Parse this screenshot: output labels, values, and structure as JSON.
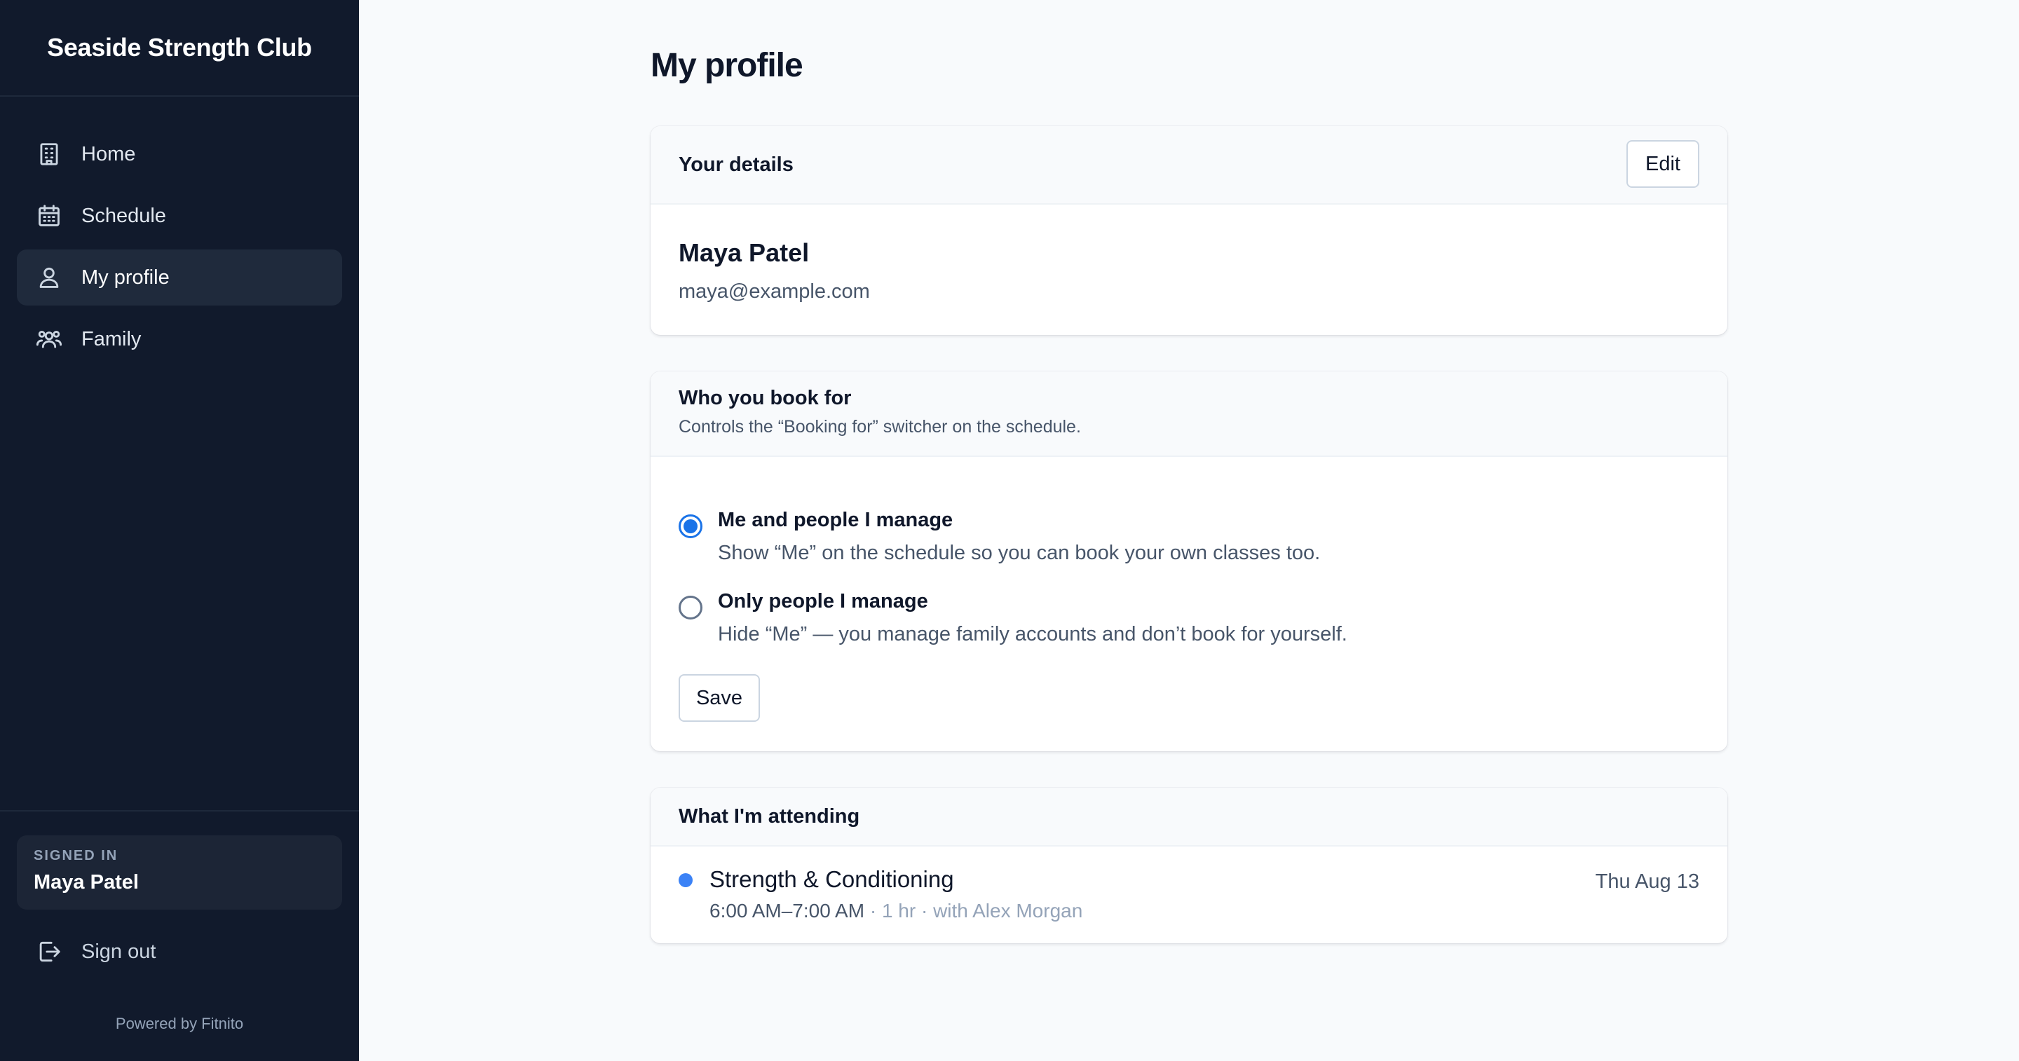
{
  "sidebar": {
    "brand": "Seaside Strength Club",
    "items": [
      {
        "label": "Home",
        "icon": "building-icon"
      },
      {
        "label": "Schedule",
        "icon": "calendar-icon"
      },
      {
        "label": "My profile",
        "icon": "user-icon",
        "active": true
      },
      {
        "label": "Family",
        "icon": "users-icon"
      }
    ],
    "signed_in_label": "SIGNED IN",
    "signed_in_name": "Maya Patel",
    "sign_out": "Sign out",
    "powered_by": "Powered by Fitnito"
  },
  "main": {
    "title": "My profile",
    "details": {
      "title": "Your details",
      "edit_label": "Edit",
      "name": "Maya Patel",
      "email": "maya@example.com"
    },
    "booking": {
      "title": "Who you book for",
      "subtitle": "Controls the “Booking for” switcher on the schedule.",
      "options": [
        {
          "title": "Me and people I manage",
          "desc": "Show “Me” on the schedule so you can book your own classes too.",
          "selected": true
        },
        {
          "title": "Only people I manage",
          "desc": "Hide “Me” — you manage family accounts and don’t book for yourself.",
          "selected": false
        }
      ],
      "save_label": "Save"
    },
    "attending": {
      "title": "What I'm attending",
      "events": [
        {
          "title": "Strength & Conditioning",
          "time": "6:00 AM–7:00 AM",
          "duration": "1 hr",
          "instructor": "with Alex Morgan",
          "date": "Thu Aug 13"
        }
      ]
    }
  },
  "colors": {
    "sidebar_bg": "#111a2c",
    "active_item_bg": "#1f2a3c",
    "accent": "#1a73e8",
    "event_dot": "#3b82f6",
    "page_bg": "#f8fafc"
  }
}
